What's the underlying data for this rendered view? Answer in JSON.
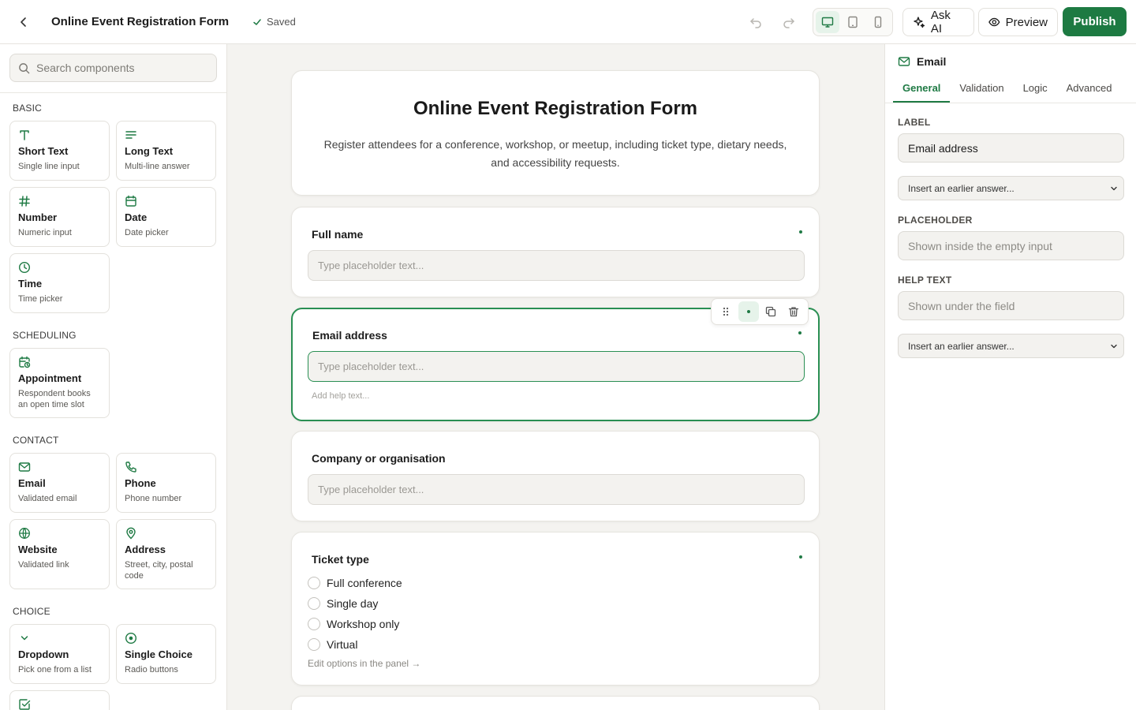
{
  "topbar": {
    "form_title": "Online Event Registration Form",
    "saved_label": "Saved",
    "ask_ai_label": "Ask AI",
    "preview_label": "Preview",
    "publish_label": "Publish"
  },
  "sidebar": {
    "search_placeholder": "Search components",
    "sections": {
      "basic": "BASIC",
      "scheduling": "SCHEDULING",
      "contact": "CONTACT",
      "choice": "CHOICE"
    },
    "components": {
      "short_text": {
        "name": "Short Text",
        "desc": "Single line input"
      },
      "long_text": {
        "name": "Long Text",
        "desc": "Multi-line answer"
      },
      "number": {
        "name": "Number",
        "desc": "Numeric input"
      },
      "date": {
        "name": "Date",
        "desc": "Date picker"
      },
      "time": {
        "name": "Time",
        "desc": "Time picker"
      },
      "appointment": {
        "name": "Appointment",
        "desc": "Respondent books an open time slot"
      },
      "email": {
        "name": "Email",
        "desc": "Validated email"
      },
      "phone": {
        "name": "Phone",
        "desc": "Phone number"
      },
      "website": {
        "name": "Website",
        "desc": "Validated link"
      },
      "address": {
        "name": "Address",
        "desc": "Street, city, postal code"
      },
      "dropdown": {
        "name": "Dropdown",
        "desc": "Pick one from a list"
      },
      "single_choice": {
        "name": "Single Choice",
        "desc": "Radio buttons"
      }
    }
  },
  "canvas": {
    "header": {
      "title": "Online Event Registration Form",
      "description": "Register attendees for a conference, workshop, or meetup, including ticket type, dietary needs, and accessibility requests."
    },
    "fields": {
      "full_name": {
        "label": "Full name",
        "placeholder": "Type placeholder text..."
      },
      "email": {
        "label": "Email address",
        "placeholder": "Type placeholder text...",
        "help": "Add help text..."
      },
      "company": {
        "label": "Company or organisation",
        "placeholder": "Type placeholder text..."
      },
      "ticket": {
        "label": "Ticket type",
        "options": [
          "Full conference",
          "Single day",
          "Workshop only",
          "Virtual"
        ],
        "edit_hint": "Edit options in the panel →"
      }
    }
  },
  "panel": {
    "title": "Email",
    "tabs": [
      "General",
      "Validation",
      "Logic",
      "Advanced"
    ],
    "label_heading": "LABEL",
    "label_value": "Email address",
    "insert_answer": "Insert an earlier answer...",
    "placeholder_heading": "PLACEHOLDER",
    "placeholder_hint": "Shown inside the empty input",
    "help_heading": "HELP TEXT",
    "help_hint": "Shown under the field"
  },
  "colors": {
    "accent": "#1f7a44",
    "publish_bg": "#1d7a42",
    "canvas_bg": "#f4f3f0"
  },
  "icons": [
    "back-icon",
    "check-icon",
    "undo-icon",
    "redo-icon",
    "desktop-icon",
    "tablet-icon",
    "mobile-icon",
    "sparkle-icon",
    "eye-icon",
    "search-icon",
    "text-icon",
    "lines-icon",
    "hash-icon",
    "calendar-icon",
    "clock-icon",
    "calendar-clock-icon",
    "mail-icon",
    "phone-icon",
    "globe-icon",
    "map-pin-icon",
    "chevron-down-icon",
    "radio-icon",
    "checkbox-icon",
    "drag-handle-icon",
    "duplicate-icon",
    "trash-icon"
  ]
}
